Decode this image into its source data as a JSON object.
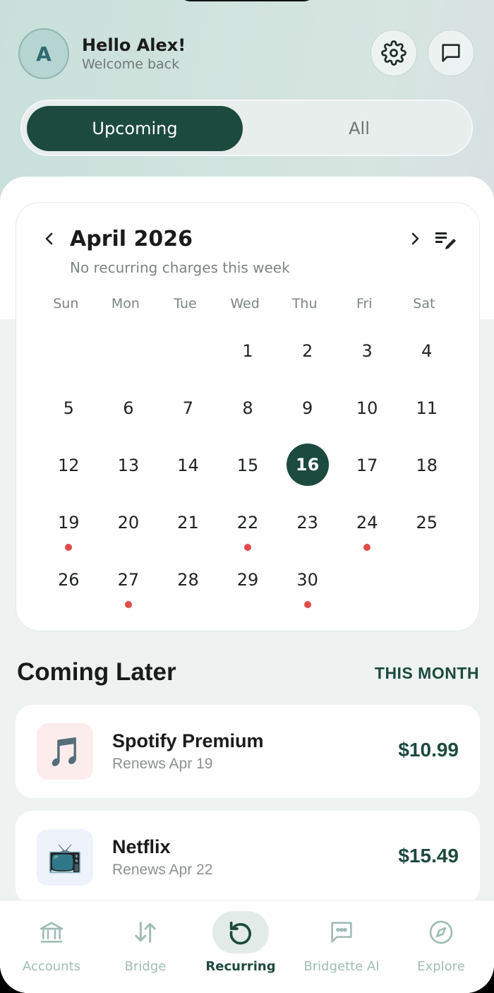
{
  "header": {
    "avatar_initial": "A",
    "greeting": "Hello Alex!",
    "subtitle": "Welcome back"
  },
  "segment": {
    "active": "Upcoming",
    "inactive": "All"
  },
  "calendar": {
    "title": "April 2026",
    "subtitle": "No recurring charges this week",
    "weekdays": [
      "Sun",
      "Mon",
      "Tue",
      "Wed",
      "Thu",
      "Fri",
      "Sat"
    ],
    "weeks": [
      [
        "",
        "",
        "",
        "1",
        "2",
        "3",
        "4"
      ],
      [
        "5",
        "6",
        "7",
        "8",
        "9",
        "10",
        "11"
      ],
      [
        "12",
        "13",
        "14",
        "15",
        "16",
        "17",
        "18"
      ],
      [
        "19",
        "20",
        "21",
        "22",
        "23",
        "24",
        "25"
      ],
      [
        "26",
        "27",
        "28",
        "29",
        "30",
        "",
        ""
      ]
    ],
    "today": "16",
    "charge_days": [
      "19",
      "22",
      "24",
      "27",
      "30"
    ],
    "dot_color": "#e04b48",
    "accent": "#1d4a3e"
  },
  "coming_later": {
    "title": "Coming Later",
    "link": "THIS MONTH",
    "items": [
      {
        "icon": "🎵",
        "icon_name": "music-note-icon",
        "icon_bg": "#fdecec",
        "name": "Spotify Premium",
        "renew": "Renews Apr 19",
        "amount": "$10.99"
      },
      {
        "icon": "📺",
        "icon_name": "television-icon",
        "icon_bg": "#edf2fb",
        "name": "Netflix",
        "renew": "Renews Apr 22",
        "amount": "$15.49"
      }
    ]
  },
  "tabs": [
    {
      "label": "Accounts",
      "icon": "bank-icon"
    },
    {
      "label": "Bridge",
      "icon": "transfer-arrows-icon"
    },
    {
      "label": "Recurring",
      "icon": "recurring-icon",
      "active": true
    },
    {
      "label": "Bridgette AI",
      "icon": "chat-bubble-icon"
    },
    {
      "label": "Explore",
      "icon": "compass-icon"
    }
  ]
}
